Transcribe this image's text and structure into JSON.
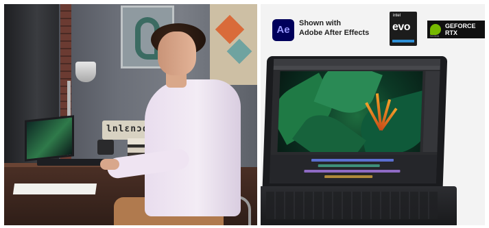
{
  "left_photo": {
    "sign_text": "lnlεnɔdo Al"
  },
  "right_panel": {
    "app_logo_text": "Ae",
    "shown_with": [
      "Shown with",
      "Adobe After Effects"
    ],
    "intel_badge": {
      "small_text": "intel",
      "main_text": "evo"
    },
    "nvidia_badge": {
      "lines": [
        "GEFORCE",
        "RTX"
      ],
      "small_text": "NVIDIA"
    }
  },
  "colors": {
    "ae_blue": "#00005b",
    "ae_text": "#9999ff",
    "nvidia_green": "#76b900",
    "evo_blue": "#2e8fd6"
  }
}
